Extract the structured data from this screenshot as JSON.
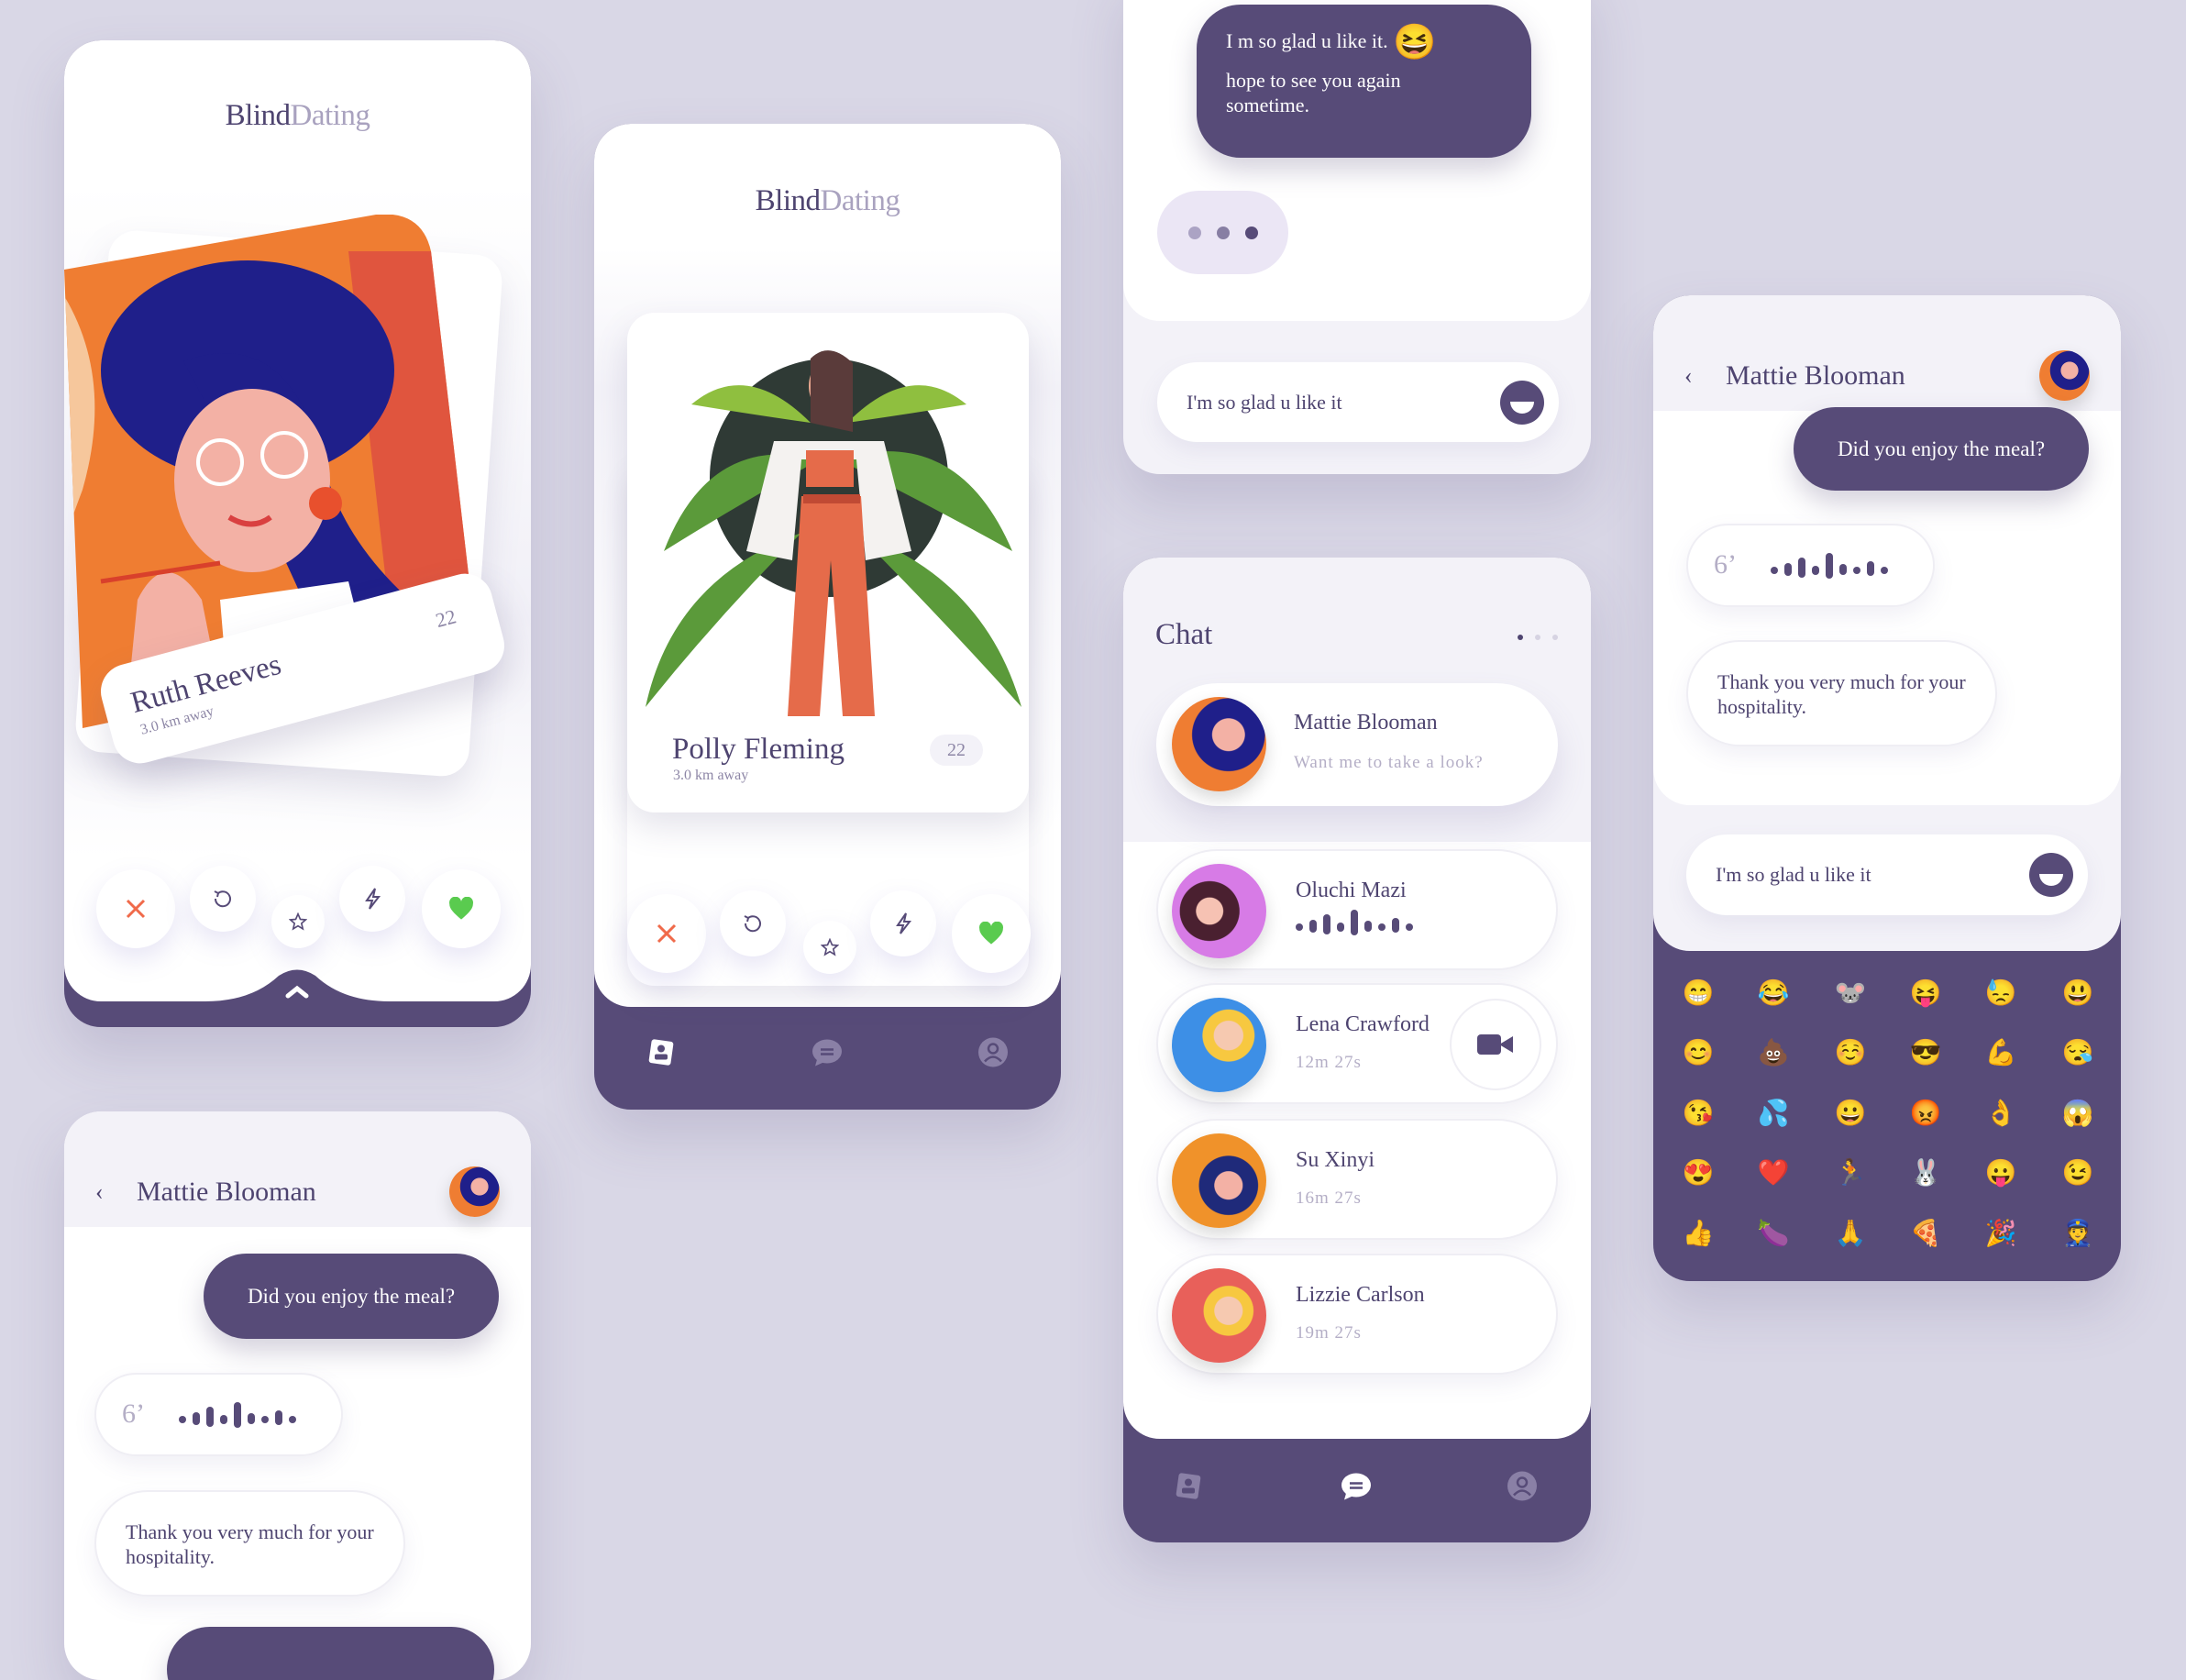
{
  "colors": {
    "background": "#d9d7e6",
    "brand_purple": "#574b78",
    "text": "#4e4470",
    "muted": "#b4aec6",
    "like_green": "#5acb4f",
    "dislike_orange": "#f06a4a"
  },
  "logo": {
    "part1": "Blind",
    "part2": "Dating"
  },
  "swipe_screen_1": {
    "profile": {
      "name": "Ruth Reeves",
      "distance": "3.0 km away",
      "age": "22"
    },
    "actions": [
      "close-icon",
      "undo-icon",
      "star-icon",
      "bolt-icon",
      "heart-icon"
    ],
    "expand_icon": "chevron-up-icon"
  },
  "swipe_screen_2": {
    "profile": {
      "name": "Polly Fleming",
      "distance": "3.0 km away",
      "age": "22"
    },
    "actions": [
      "close-icon",
      "undo-icon",
      "star-icon",
      "bolt-icon",
      "heart-icon"
    ],
    "nav": [
      {
        "icon": "profile-card-icon",
        "active": true
      },
      {
        "icon": "chat-icon",
        "active": false
      },
      {
        "icon": "user-icon",
        "active": false
      }
    ]
  },
  "conversation_top": {
    "message_line1": "I m so glad u like it.",
    "message_emoji": "😆",
    "message_line2": "hope to see you again sometime.",
    "typing_indicator": "typing",
    "input_value": "I'm so glad u like it"
  },
  "chat_list": {
    "title": "Chat",
    "page_dots": 3,
    "active_page": 1,
    "items": [
      {
        "name": "Mattie Blooman",
        "preview": "Want me to take a look?",
        "type": "text"
      },
      {
        "name": "Oluchi Mazi",
        "preview": "",
        "type": "voice"
      },
      {
        "name": "Lena Crawford",
        "preview": "12m 27s",
        "type": "video-call"
      },
      {
        "name": "Su Xinyi",
        "preview": "16m 27s",
        "type": "call"
      },
      {
        "name": "Lizzie Carlson",
        "preview": "19m 27s",
        "type": "call"
      }
    ],
    "nav": [
      {
        "icon": "profile-card-icon",
        "active": false
      },
      {
        "icon": "chat-icon",
        "active": true
      },
      {
        "icon": "user-icon",
        "active": false
      }
    ]
  },
  "conversation_emoji": {
    "contact": "Mattie Blooman",
    "message_sent": "Did you enjoy the meal?",
    "voice_duration": "6’",
    "message_received": "Thank you very much for your hospitality.",
    "input_value": "I'm so glad u like it",
    "emojis": [
      "😁",
      "😂",
      "🐭",
      "😝",
      "😓",
      "😃",
      "😊",
      "💩",
      "☺️",
      "😎",
      "💪",
      "😪",
      "😘",
      "💦",
      "😀",
      "😡",
      "👌",
      "😱",
      "😍",
      "❤️",
      "🏃",
      "🐰",
      "😛",
      "😉",
      "👍",
      "🍆",
      "🙏",
      "🍕",
      "🎉",
      "👮"
    ]
  },
  "conversation_bottom": {
    "contact": "Mattie Blooman",
    "message_sent": "Did you enjoy the meal?",
    "voice_duration": "6’",
    "message_received": "Thank you very much for your hospitality."
  }
}
